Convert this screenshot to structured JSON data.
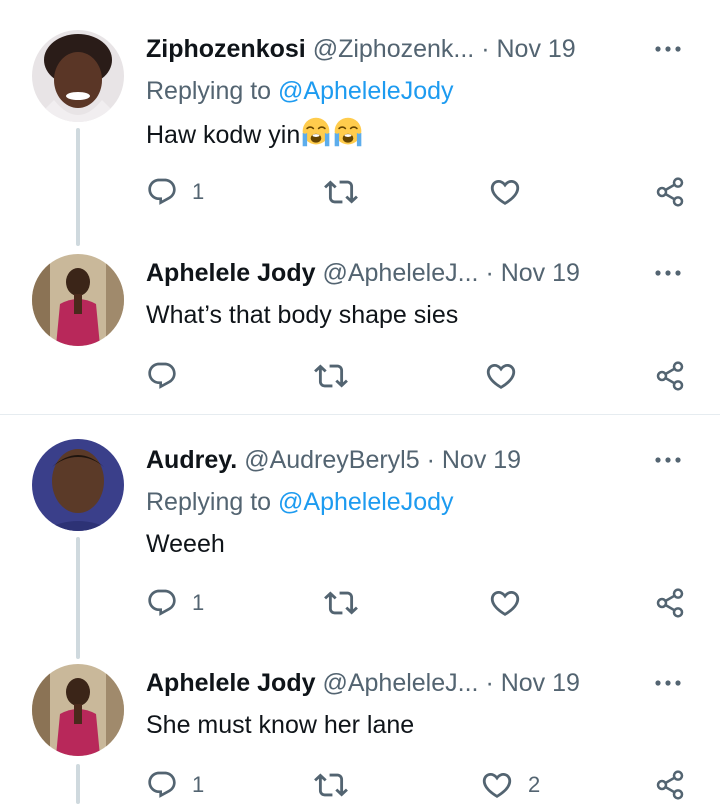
{
  "tweets": [
    {
      "name": "Ziphozenkosi",
      "handle": "@Ziphozenk...",
      "sep": "·",
      "date": "Nov 19",
      "replying_prefix": "Replying to ",
      "replying_to": "@ApheleleJody",
      "text": "Haw kodw yin",
      "text_emoji": [
        "loudly-crying-face",
        "loudly-crying-face"
      ],
      "reply_count": "1",
      "retweet_count": "",
      "like_count": ""
    },
    {
      "name": "Aphelele Jody",
      "handle": "@ApheleleJ...",
      "sep": "·",
      "date": "Nov 19",
      "text": "What’s that body shape sies",
      "reply_count": "",
      "retweet_count": "",
      "like_count": ""
    },
    {
      "name": "Audrey.",
      "handle": "@AudreyBeryl5",
      "sep": "·",
      "date": "Nov 19",
      "replying_prefix": "Replying to ",
      "replying_to": "@ApheleleJody",
      "text": "Weeeh",
      "reply_count": "1",
      "retweet_count": "",
      "like_count": ""
    },
    {
      "name": "Aphelele Jody",
      "handle": "@ApheleleJ...",
      "sep": "·",
      "date": "Nov 19",
      "text": "She must know her lane",
      "reply_count": "1",
      "retweet_count": "",
      "like_count": "2"
    }
  ],
  "colors": {
    "text": "#0f1419",
    "secondary": "#536471",
    "link": "#1d9bf0",
    "thread_line": "#cfd9de",
    "divider": "#e6ecf0"
  },
  "icons": [
    "reply-icon",
    "retweet-icon",
    "like-icon",
    "share-icon",
    "more-icon",
    "loudly-crying-face-emoji"
  ]
}
